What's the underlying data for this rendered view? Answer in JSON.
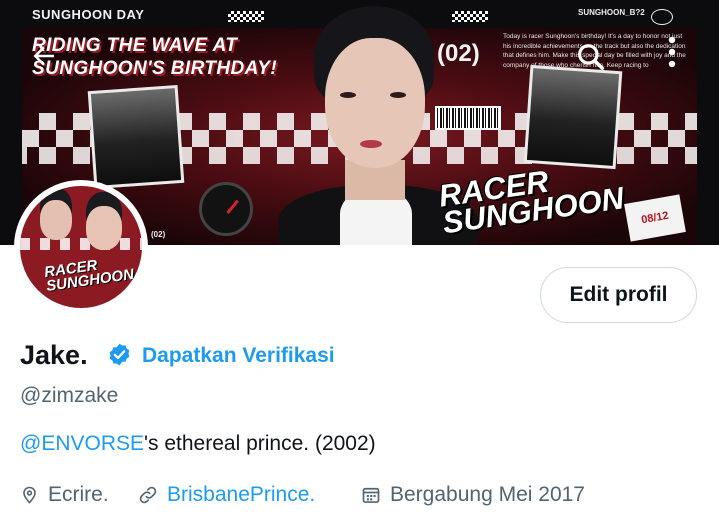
{
  "banner": {
    "brand": "SUNGHOON DAY",
    "headline_line1": "RIDING THE WAVE AT",
    "headline_line2": "SUNGHOON'S BIRTHDAY!",
    "number": "(02)",
    "tag": "SUNGHOON_B?2",
    "paragraph": "Today is racer Sunghoon's birthday! It's a day to honor not just his incredible achievements on the track but also the dedication that defines him. Make this special day be filled with joy and the company of those who cherish him. Keep racing to",
    "racer_text_line1": "RACER",
    "racer_text_line2": "SUNGHOON",
    "ticket": "08/12",
    "small_number": "(02)"
  },
  "avatar": {
    "text_line1": "RACER",
    "text_line2": "SUNGHOON"
  },
  "actions": {
    "edit_profile_label": "Edit profil"
  },
  "profile": {
    "name": "Jake.",
    "verify_label": "Dapatkan Verifikasi",
    "handle": "@zimzake",
    "bio_mention": "@ENVORSE",
    "bio_rest": "'s ethereal prince. (2002)",
    "location": "Ecrire.",
    "website": "BrisbanePrince.",
    "joined": "Bergabung Mei 2017"
  },
  "colors": {
    "accent": "#1d9bf0",
    "secondary_text": "#536471",
    "primary_text": "#0f1419",
    "border": "#cfd9de"
  },
  "icons": {
    "back": "arrow-left-icon",
    "search": "search-icon",
    "more": "more-vertical-icon",
    "verified": "verified-badge-icon",
    "location": "location-pin-icon",
    "link": "link-icon",
    "calendar": "calendar-icon"
  }
}
